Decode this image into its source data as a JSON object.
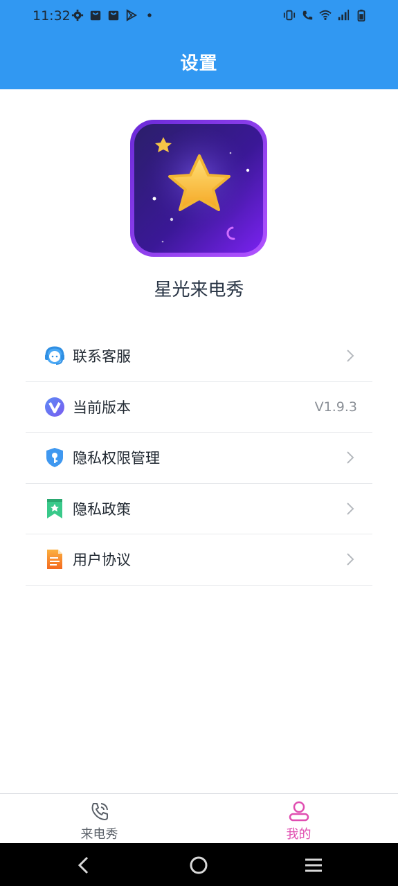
{
  "status_bar": {
    "time": "11:32",
    "left_icons": [
      "settings-icon",
      "shopping-bag-icon",
      "shopping-bag-icon",
      "play-store-icon",
      "dot-icon"
    ],
    "right_icons": [
      "vibrate-icon",
      "wifi-calling-icon",
      "wifi-icon",
      "signal-icon",
      "battery-icon"
    ]
  },
  "header": {
    "title": "设置",
    "color": "#3198f2"
  },
  "app": {
    "name": "星光来电秀",
    "icon": "star-app-icon"
  },
  "menu": {
    "items": [
      {
        "label": "联系客服",
        "icon": "customer-service-icon",
        "trailing": "chevron"
      },
      {
        "label": "当前版本",
        "icon": "version-icon",
        "trailing": "value",
        "value": "V1.9.3"
      },
      {
        "label": "隐私权限管理",
        "icon": "shield-key-icon",
        "trailing": "chevron"
      },
      {
        "label": "隐私政策",
        "icon": "bookmark-star-icon",
        "trailing": "chevron"
      },
      {
        "label": "用户协议",
        "icon": "document-icon",
        "trailing": "chevron"
      }
    ]
  },
  "tabbar": {
    "tabs": [
      {
        "label": "来电秀",
        "icon": "phone-icon",
        "active": false
      },
      {
        "label": "我的",
        "icon": "user-icon",
        "active": true
      }
    ],
    "active_color": "#e04eb1"
  },
  "nav_bar": {
    "buttons": [
      "back-icon",
      "home-icon",
      "recents-icon"
    ]
  }
}
